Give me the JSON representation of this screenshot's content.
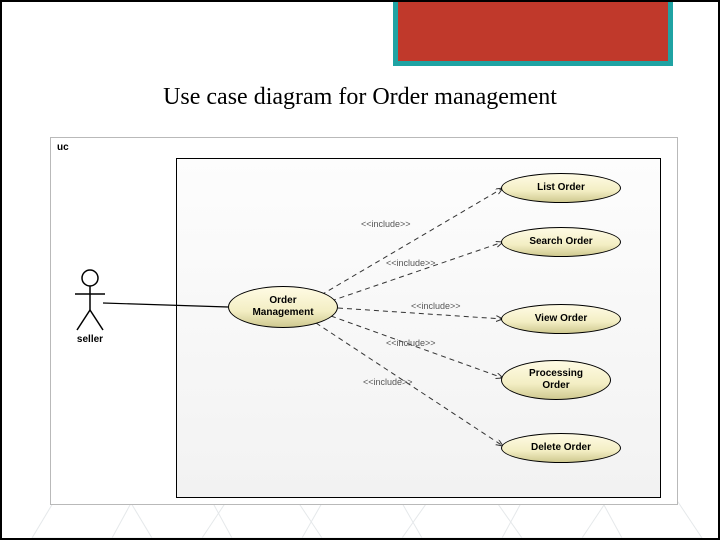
{
  "title": "Use case diagram for Order management",
  "diagram": {
    "frame_label": "uc",
    "actor": {
      "name": "seller"
    },
    "main_usecase": "Order Management",
    "usecases": [
      {
        "label": "List Order"
      },
      {
        "label": "Search Order"
      },
      {
        "label": "View Order"
      },
      {
        "label": "Processing Order"
      },
      {
        "label": "Delete Order"
      }
    ],
    "include_label": "<<include>>"
  }
}
